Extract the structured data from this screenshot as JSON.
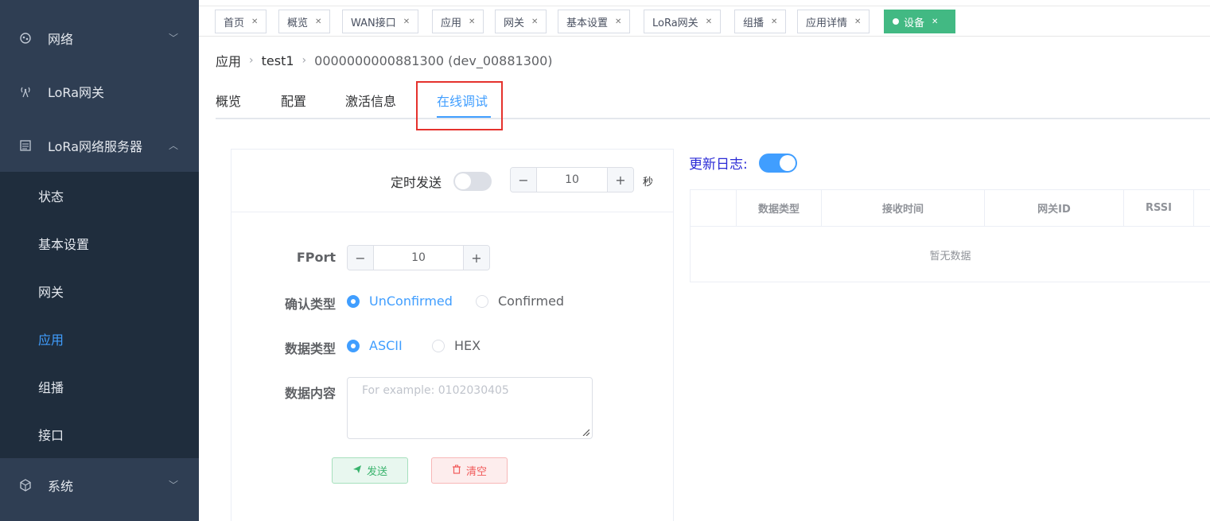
{
  "sidebar": {
    "top_items": [
      {
        "label": "网络",
        "icon": "network-icon"
      },
      {
        "label": "LoRa网关",
        "icon": "antenna-icon"
      },
      {
        "label": "LoRa网络服务器",
        "icon": "server-icon"
      }
    ],
    "sub_items": [
      {
        "label": "状态"
      },
      {
        "label": "基本设置"
      },
      {
        "label": "网关"
      },
      {
        "label": "应用",
        "active": true
      },
      {
        "label": "组播"
      },
      {
        "label": "接口"
      }
    ],
    "bottom_item": {
      "label": "系统",
      "icon": "system-icon"
    },
    "accent": "#409eff"
  },
  "tags": [
    "首页",
    "概览",
    "WAN接口",
    "应用",
    "网关",
    "基本设置",
    "LoRa网关",
    "组播",
    "应用详情",
    "设备"
  ],
  "active_tag": "设备",
  "breadcrumb": {
    "root": "应用",
    "app": "test1",
    "device": "0000000000881300 (dev_00881300)"
  },
  "page_tabs": [
    "概览",
    "配置",
    "激活信息",
    "在线调试"
  ],
  "active_page_tab": "在线调试",
  "sender": {
    "timer_label": "定时发送",
    "timer_enabled": false,
    "interval_value": "10",
    "interval_unit": "秒",
    "fport_label": "FPort",
    "fport_value": "10",
    "confirm_label": "确认类型",
    "confirm_options": [
      "UnConfirmed",
      "Confirmed"
    ],
    "confirm_selected": "UnConfirmed",
    "datatype_label": "数据类型",
    "datatype_options": [
      "ASCII",
      "HEX"
    ],
    "datatype_selected": "ASCII",
    "content_label": "数据内容",
    "content_placeholder": "For example: 0102030405",
    "send_label": "发送",
    "clear_label": "清空"
  },
  "log": {
    "title": "更新日志:",
    "enabled": true,
    "columns": [
      "",
      "数据类型",
      "接收时间",
      "网关ID",
      "RSSI"
    ],
    "empty_text": "暂无数据"
  }
}
